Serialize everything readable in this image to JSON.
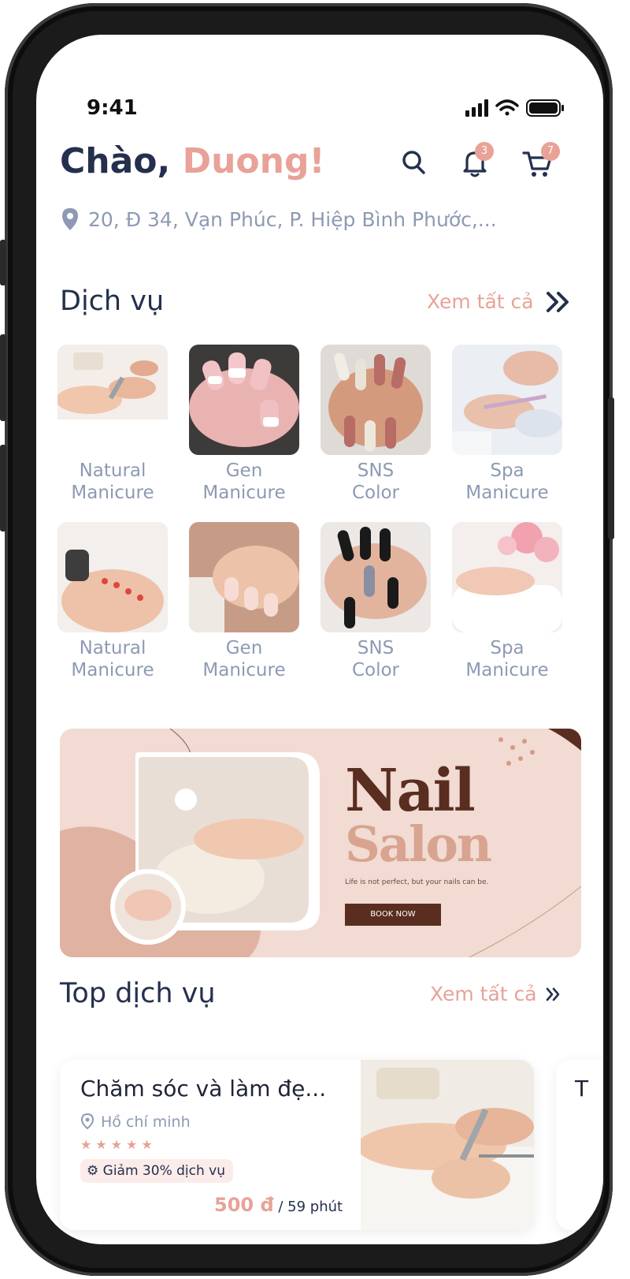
{
  "status": {
    "time": "9:41"
  },
  "header": {
    "greeting": "Chào,",
    "name": "Duong!",
    "notifications_count": "3",
    "cart_count": "7",
    "address": "20, Đ 34, Vạn Phúc, P. Hiệp Bình Phước,..."
  },
  "services_section": {
    "title": "Dịch vụ",
    "see_all": "Xem tất cả",
    "items": [
      {
        "line1": "Natural",
        "line2": "Manicure"
      },
      {
        "line1": "Gen",
        "line2": "Manicure"
      },
      {
        "line1": "SNS",
        "line2": "Color"
      },
      {
        "line1": "Spa",
        "line2": "Manicure"
      },
      {
        "line1": "Natural",
        "line2": "Manicure"
      },
      {
        "line1": "Gen",
        "line2": "Manicure"
      },
      {
        "line1": "SNS",
        "line2": "Color"
      },
      {
        "line1": "Spa",
        "line2": "Manicure"
      }
    ]
  },
  "banner": {
    "title_line1": "Nail",
    "title_line2": "Salon",
    "tagline": "Life is not perfect, but your nails can be.",
    "button": "BOOK NOW"
  },
  "top_section": {
    "title": "Top dịch vụ",
    "see_all": "Xem tất cả",
    "cards": [
      {
        "title": "Chăm sóc và làm đẹ...",
        "location": "Hồ chí minh",
        "rating": 5,
        "promo": "Giảm 30% dịch vụ",
        "price": "500 đ",
        "duration": " / 59 phút"
      },
      {
        "title": "T"
      }
    ]
  }
}
